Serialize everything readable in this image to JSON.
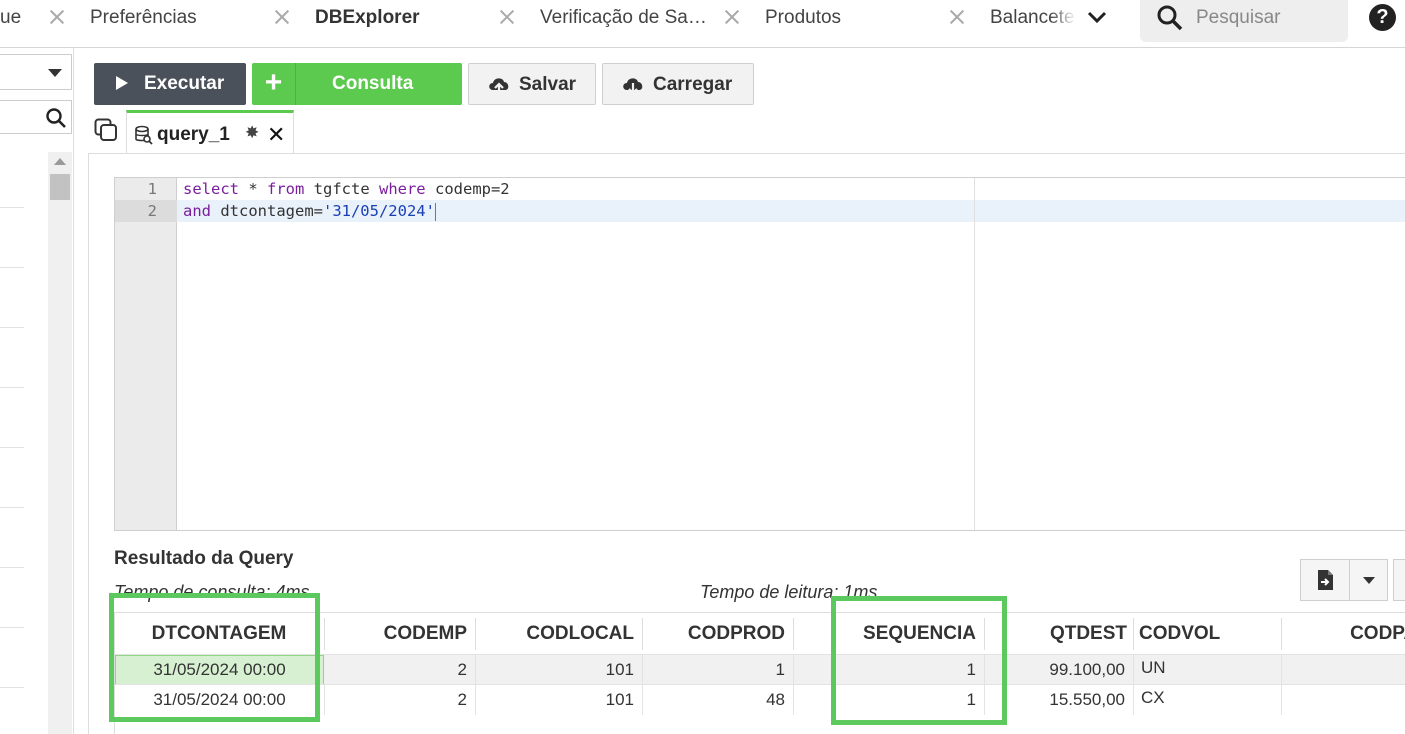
{
  "top_tabs": [
    {
      "label": "ue"
    },
    {
      "label": "Preferências"
    },
    {
      "label": "DBExplorer",
      "active": true
    },
    {
      "label": "Verificação de Sa…"
    },
    {
      "label": "Produtos"
    },
    {
      "label": "Balancete"
    }
  ],
  "search": {
    "placeholder": "Pesquisar"
  },
  "help_label": "?",
  "toolbar": {
    "execute_label": "Executar",
    "query_label": "Consulta",
    "query_plus": "+",
    "save_label": "Salvar",
    "load_label": "Carregar"
  },
  "query_tab": {
    "label": "query_1",
    "modified_mark": "✸",
    "close": "✕"
  },
  "editor": {
    "line_numbers": [
      "1",
      "2"
    ],
    "line1": {
      "kw1": "select",
      "t1": " * ",
      "kw2": "from",
      "t2": " tgfcte ",
      "kw3": "where",
      "t3": " codemp=2"
    },
    "line2": {
      "kw1": "and",
      "t1": " dtcontagem=",
      "str": "'31/05/2024'"
    }
  },
  "results": {
    "title": "Resultado da Query",
    "query_time": "Tempo de consulta: 4ms",
    "read_time": "Tempo de leitura: 1ms",
    "columns": [
      "DTCONTAGEM",
      "CODEMP",
      "CODLOCAL",
      "CODPROD",
      "SEQUENCIA",
      "QTDEST",
      "CODVOL",
      "CODPAR"
    ],
    "rows": [
      [
        "31/05/2024 00:00",
        "2",
        "101",
        "1",
        "1",
        "99.100,00",
        "UN",
        ""
      ],
      [
        "31/05/2024 00:00",
        "2",
        "101",
        "48",
        "1",
        "15.550,00",
        "CX",
        ""
      ]
    ]
  },
  "colors": {
    "accent_green": "#5cc94f",
    "highlight_green": "#5cc95f",
    "dark_button": "#4a515b"
  }
}
